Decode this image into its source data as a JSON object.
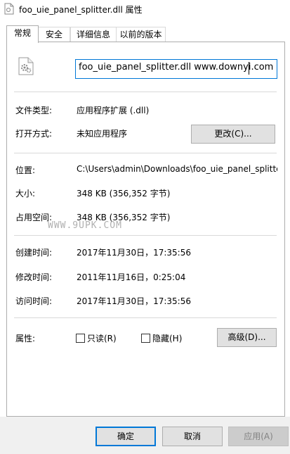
{
  "window": {
    "title": "foo_uie_panel_splitter.dll 属性"
  },
  "tabs": [
    {
      "label": "常规",
      "active": true
    },
    {
      "label": "安全",
      "active": false
    },
    {
      "label": "详细信息",
      "active": false
    },
    {
      "label": "以前的版本",
      "active": false
    }
  ],
  "general": {
    "file_name": "foo_uie_panel_splitter.dll www.downyi.com",
    "file_type_label": "文件类型:",
    "file_type_value": "应用程序扩展 (.dll)",
    "opens_with_label": "打开方式:",
    "opens_with_value": "未知应用程序",
    "change_button": "更改(C)...",
    "location_label": "位置:",
    "location_value": "C:\\Users\\admin\\Downloads\\foo_uie_panel_splitter",
    "size_label": "大小:",
    "size_value": "348 KB (356,352 字节)",
    "size_on_disk_label": "占用空间:",
    "size_on_disk_value": "348 KB (356,352 字节)",
    "watermark": "WWW.9UPK.COM",
    "created_label": "创建时间:",
    "created_value": "2017年11月30日，17:35:56",
    "modified_label": "修改时间:",
    "modified_value": "2011年11月16日，0:25:04",
    "accessed_label": "访问时间:",
    "accessed_value": "2017年11月30日，17:35:56",
    "attributes_label": "属性:",
    "readonly_label": "只读(R)",
    "readonly_checked": false,
    "hidden_label": "隐藏(H)",
    "hidden_checked": false,
    "advanced_button": "高级(D)..."
  },
  "footer": {
    "ok": "确定",
    "cancel": "取消",
    "apply": "应用(A)"
  },
  "colors": {
    "accent": "#0078d7",
    "footer_bg": "#f0f0f0",
    "button_bg": "#e1e1e1"
  }
}
